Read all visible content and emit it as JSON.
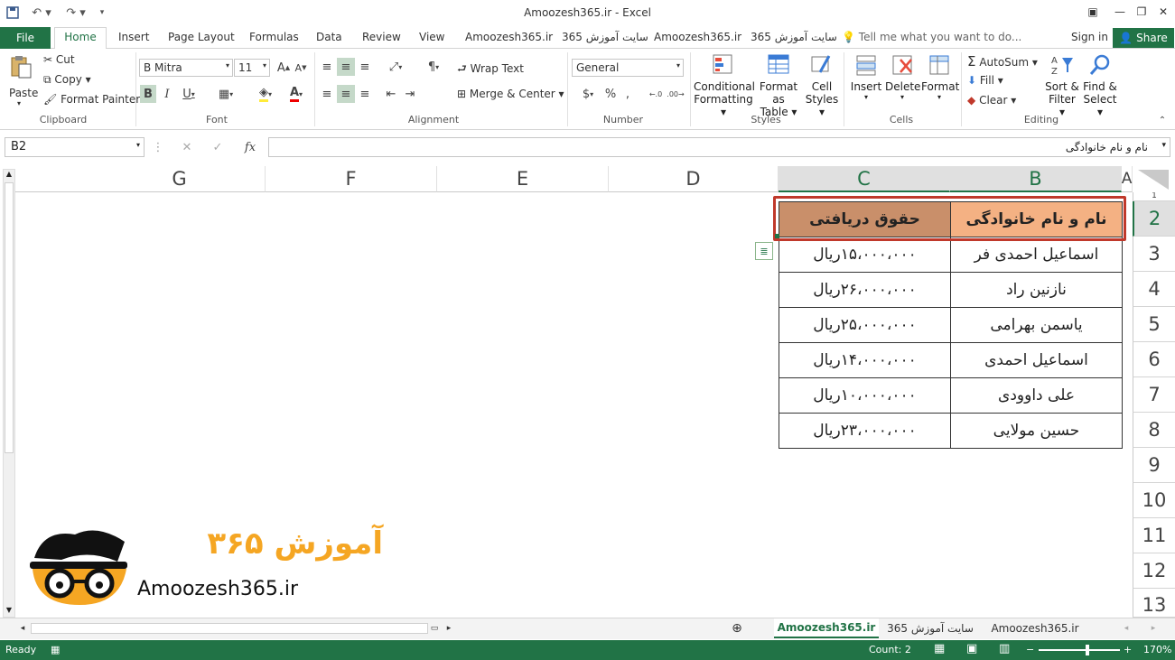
{
  "window": {
    "title": "Amoozesh365.ir - Excel"
  },
  "tabs": {
    "file": "File",
    "home": "Home",
    "insert": "Insert",
    "page_layout": "Page Layout",
    "formulas": "Formulas",
    "data": "Data",
    "review": "Review",
    "view": "View",
    "custom1": "Amoozesh365.ir",
    "custom2": "سایت آموزش 365",
    "custom3": "Amoozesh365.ir",
    "custom4": "سایت آموزش 365",
    "tell_me": "Tell me what you want to do...",
    "sign_in": "Sign in",
    "share": "Share"
  },
  "ribbon": {
    "clipboard": {
      "paste": "Paste",
      "cut": "Cut",
      "copy": "Copy",
      "format_painter": "Format Painter",
      "label": "Clipboard"
    },
    "font": {
      "font_name": "B Mitra",
      "font_size": "11",
      "label": "Font"
    },
    "alignment": {
      "wrap_text": "Wrap Text",
      "merge_center": "Merge & Center",
      "label": "Alignment"
    },
    "number": {
      "format": "General",
      "label": "Number"
    },
    "styles": {
      "conditional_1": "Conditional",
      "conditional_2": "Formatting",
      "format_as_1": "Format as",
      "format_as_2": "Table",
      "cell_styles_1": "Cell",
      "cell_styles_2": "Styles",
      "label": "Styles"
    },
    "cells": {
      "insert": "Insert",
      "delete": "Delete",
      "format": "Format",
      "label": "Cells"
    },
    "editing": {
      "autosum": "AutoSum",
      "fill": "Fill",
      "clear": "Clear",
      "sort_1": "Sort &",
      "sort_2": "Filter",
      "find_1": "Find &",
      "find_2": "Select",
      "label": "Editing"
    }
  },
  "formula_bar": {
    "name_box": "B2",
    "content": "نام و نام خانوادگی"
  },
  "columns": [
    "G",
    "F",
    "E",
    "D",
    "C",
    "B",
    "A"
  ],
  "rows": [
    "1",
    "2",
    "3",
    "4",
    "5",
    "6",
    "7",
    "8",
    "9",
    "10",
    "11",
    "12",
    "13"
  ],
  "table": {
    "header": {
      "name": "نام و نام خانوادگی",
      "salary": "حقوق دریافتی"
    },
    "rows": [
      {
        "name": "اسماعیل احمدی فر",
        "salary": "۱۵،۰۰۰،۰۰۰ریال"
      },
      {
        "name": "نازنین راد",
        "salary": "۲۶،۰۰۰،۰۰۰ریال"
      },
      {
        "name": "یاسمن بهرامی",
        "salary": "۲۵،۰۰۰،۰۰۰ریال"
      },
      {
        "name": "اسماعیل احمدی",
        "salary": "۱۴،۰۰۰،۰۰۰ریال"
      },
      {
        "name": "علی داوودی",
        "salary": "۱۰،۰۰۰،۰۰۰ریال"
      },
      {
        "name": "حسین مولایی",
        "salary": "۲۳،۰۰۰،۰۰۰ریال"
      }
    ],
    "colors": {
      "salary_header_bg": "#c98f6a",
      "name_header_bg": "#f4b183",
      "selection_border": "#c0392b"
    }
  },
  "logo": {
    "persian_text": "آموزش ۳۶۵",
    "latin_text": "Amoozesh365.ir",
    "accent": "#f5a623"
  },
  "sheet_tabs": {
    "tab1": "Amoozesh365.ir",
    "tab2": "سایت آموزش 365",
    "tab3": "Amoozesh365.ir"
  },
  "status": {
    "ready": "Ready",
    "count": "Count: 2",
    "zoom": "170%"
  },
  "colors": {
    "excel_green": "#217346"
  }
}
